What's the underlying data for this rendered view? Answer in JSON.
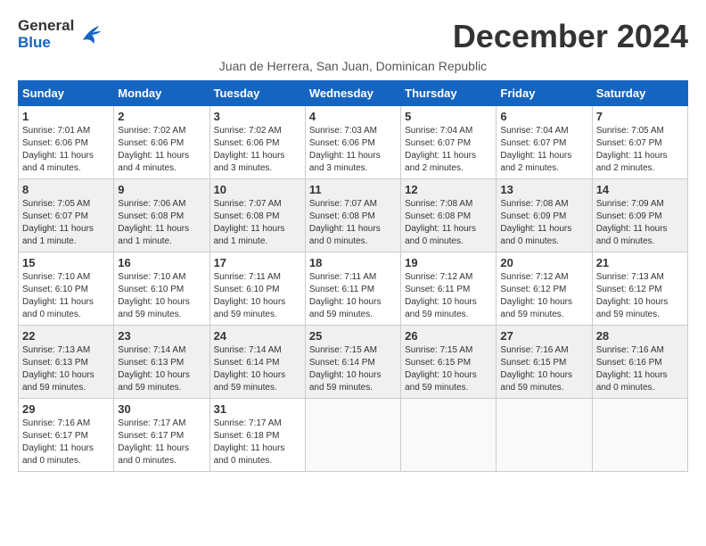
{
  "header": {
    "logo_general": "General",
    "logo_blue": "Blue",
    "month_title": "December 2024",
    "subtitle": "Juan de Herrera, San Juan, Dominican Republic"
  },
  "weekdays": [
    "Sunday",
    "Monday",
    "Tuesday",
    "Wednesday",
    "Thursday",
    "Friday",
    "Saturday"
  ],
  "weeks": [
    [
      {
        "day": "1",
        "sunrise": "Sunrise: 7:01 AM",
        "sunset": "Sunset: 6:06 PM",
        "daylight": "Daylight: 11 hours and 4 minutes."
      },
      {
        "day": "2",
        "sunrise": "Sunrise: 7:02 AM",
        "sunset": "Sunset: 6:06 PM",
        "daylight": "Daylight: 11 hours and 4 minutes."
      },
      {
        "day": "3",
        "sunrise": "Sunrise: 7:02 AM",
        "sunset": "Sunset: 6:06 PM",
        "daylight": "Daylight: 11 hours and 3 minutes."
      },
      {
        "day": "4",
        "sunrise": "Sunrise: 7:03 AM",
        "sunset": "Sunset: 6:06 PM",
        "daylight": "Daylight: 11 hours and 3 minutes."
      },
      {
        "day": "5",
        "sunrise": "Sunrise: 7:04 AM",
        "sunset": "Sunset: 6:07 PM",
        "daylight": "Daylight: 11 hours and 2 minutes."
      },
      {
        "day": "6",
        "sunrise": "Sunrise: 7:04 AM",
        "sunset": "Sunset: 6:07 PM",
        "daylight": "Daylight: 11 hours and 2 minutes."
      },
      {
        "day": "7",
        "sunrise": "Sunrise: 7:05 AM",
        "sunset": "Sunset: 6:07 PM",
        "daylight": "Daylight: 11 hours and 2 minutes."
      }
    ],
    [
      {
        "day": "8",
        "sunrise": "Sunrise: 7:05 AM",
        "sunset": "Sunset: 6:07 PM",
        "daylight": "Daylight: 11 hours and 1 minute."
      },
      {
        "day": "9",
        "sunrise": "Sunrise: 7:06 AM",
        "sunset": "Sunset: 6:08 PM",
        "daylight": "Daylight: 11 hours and 1 minute."
      },
      {
        "day": "10",
        "sunrise": "Sunrise: 7:07 AM",
        "sunset": "Sunset: 6:08 PM",
        "daylight": "Daylight: 11 hours and 1 minute."
      },
      {
        "day": "11",
        "sunrise": "Sunrise: 7:07 AM",
        "sunset": "Sunset: 6:08 PM",
        "daylight": "Daylight: 11 hours and 0 minutes."
      },
      {
        "day": "12",
        "sunrise": "Sunrise: 7:08 AM",
        "sunset": "Sunset: 6:08 PM",
        "daylight": "Daylight: 11 hours and 0 minutes."
      },
      {
        "day": "13",
        "sunrise": "Sunrise: 7:08 AM",
        "sunset": "Sunset: 6:09 PM",
        "daylight": "Daylight: 11 hours and 0 minutes."
      },
      {
        "day": "14",
        "sunrise": "Sunrise: 7:09 AM",
        "sunset": "Sunset: 6:09 PM",
        "daylight": "Daylight: 11 hours and 0 minutes."
      }
    ],
    [
      {
        "day": "15",
        "sunrise": "Sunrise: 7:10 AM",
        "sunset": "Sunset: 6:10 PM",
        "daylight": "Daylight: 11 hours and 0 minutes."
      },
      {
        "day": "16",
        "sunrise": "Sunrise: 7:10 AM",
        "sunset": "Sunset: 6:10 PM",
        "daylight": "Daylight: 10 hours and 59 minutes."
      },
      {
        "day": "17",
        "sunrise": "Sunrise: 7:11 AM",
        "sunset": "Sunset: 6:10 PM",
        "daylight": "Daylight: 10 hours and 59 minutes."
      },
      {
        "day": "18",
        "sunrise": "Sunrise: 7:11 AM",
        "sunset": "Sunset: 6:11 PM",
        "daylight": "Daylight: 10 hours and 59 minutes."
      },
      {
        "day": "19",
        "sunrise": "Sunrise: 7:12 AM",
        "sunset": "Sunset: 6:11 PM",
        "daylight": "Daylight: 10 hours and 59 minutes."
      },
      {
        "day": "20",
        "sunrise": "Sunrise: 7:12 AM",
        "sunset": "Sunset: 6:12 PM",
        "daylight": "Daylight: 10 hours and 59 minutes."
      },
      {
        "day": "21",
        "sunrise": "Sunrise: 7:13 AM",
        "sunset": "Sunset: 6:12 PM",
        "daylight": "Daylight: 10 hours and 59 minutes."
      }
    ],
    [
      {
        "day": "22",
        "sunrise": "Sunrise: 7:13 AM",
        "sunset": "Sunset: 6:13 PM",
        "daylight": "Daylight: 10 hours and 59 minutes."
      },
      {
        "day": "23",
        "sunrise": "Sunrise: 7:14 AM",
        "sunset": "Sunset: 6:13 PM",
        "daylight": "Daylight: 10 hours and 59 minutes."
      },
      {
        "day": "24",
        "sunrise": "Sunrise: 7:14 AM",
        "sunset": "Sunset: 6:14 PM",
        "daylight": "Daylight: 10 hours and 59 minutes."
      },
      {
        "day": "25",
        "sunrise": "Sunrise: 7:15 AM",
        "sunset": "Sunset: 6:14 PM",
        "daylight": "Daylight: 10 hours and 59 minutes."
      },
      {
        "day": "26",
        "sunrise": "Sunrise: 7:15 AM",
        "sunset": "Sunset: 6:15 PM",
        "daylight": "Daylight: 10 hours and 59 minutes."
      },
      {
        "day": "27",
        "sunrise": "Sunrise: 7:16 AM",
        "sunset": "Sunset: 6:15 PM",
        "daylight": "Daylight: 10 hours and 59 minutes."
      },
      {
        "day": "28",
        "sunrise": "Sunrise: 7:16 AM",
        "sunset": "Sunset: 6:16 PM",
        "daylight": "Daylight: 11 hours and 0 minutes."
      }
    ],
    [
      {
        "day": "29",
        "sunrise": "Sunrise: 7:16 AM",
        "sunset": "Sunset: 6:17 PM",
        "daylight": "Daylight: 11 hours and 0 minutes."
      },
      {
        "day": "30",
        "sunrise": "Sunrise: 7:17 AM",
        "sunset": "Sunset: 6:17 PM",
        "daylight": "Daylight: 11 hours and 0 minutes."
      },
      {
        "day": "31",
        "sunrise": "Sunrise: 7:17 AM",
        "sunset": "Sunset: 6:18 PM",
        "daylight": "Daylight: 11 hours and 0 minutes."
      },
      null,
      null,
      null,
      null
    ]
  ]
}
